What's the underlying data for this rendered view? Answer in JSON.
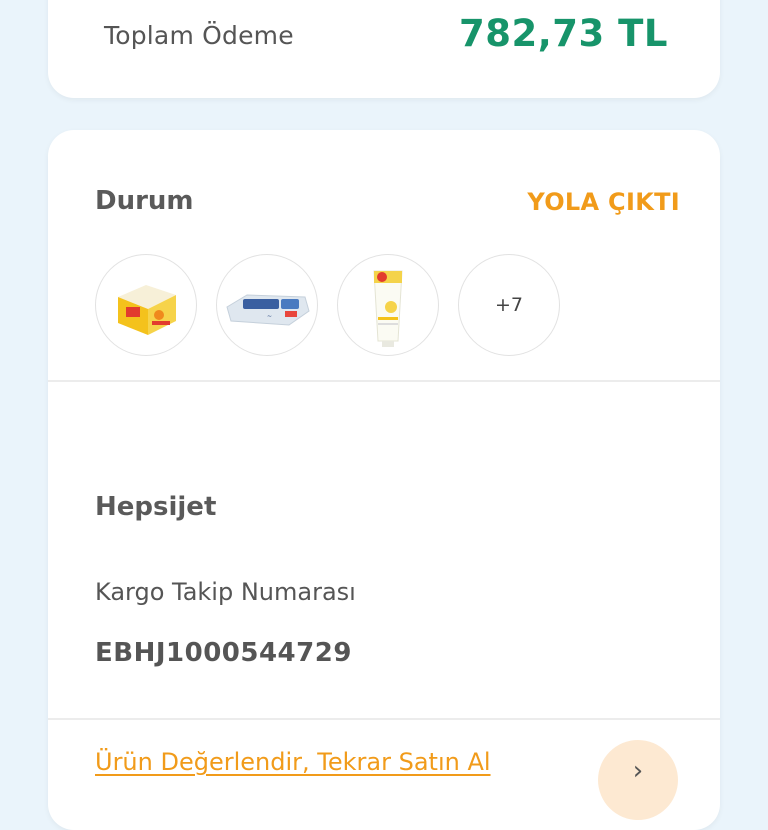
{
  "payment": {
    "label": "Toplam Ödeme",
    "amount": "782,73 TL"
  },
  "order": {
    "status_label": "Durum",
    "status_value": "YOLA ÇIKTI",
    "more_count": "+7",
    "carrier": "Hepsijet",
    "tracking_label": "Kargo Takip Numarası",
    "tracking_number": "EBHJ1000544729",
    "action_link": "Ürün Değerlendir, Tekrar Satın Al",
    "action_button_icon": "chevron-right-icon"
  },
  "colors": {
    "background": "#eaf4fb",
    "card": "#ffffff",
    "amount_green": "#17946a",
    "accent_orange": "#f19b1a",
    "button_bg": "#fde9d2"
  }
}
